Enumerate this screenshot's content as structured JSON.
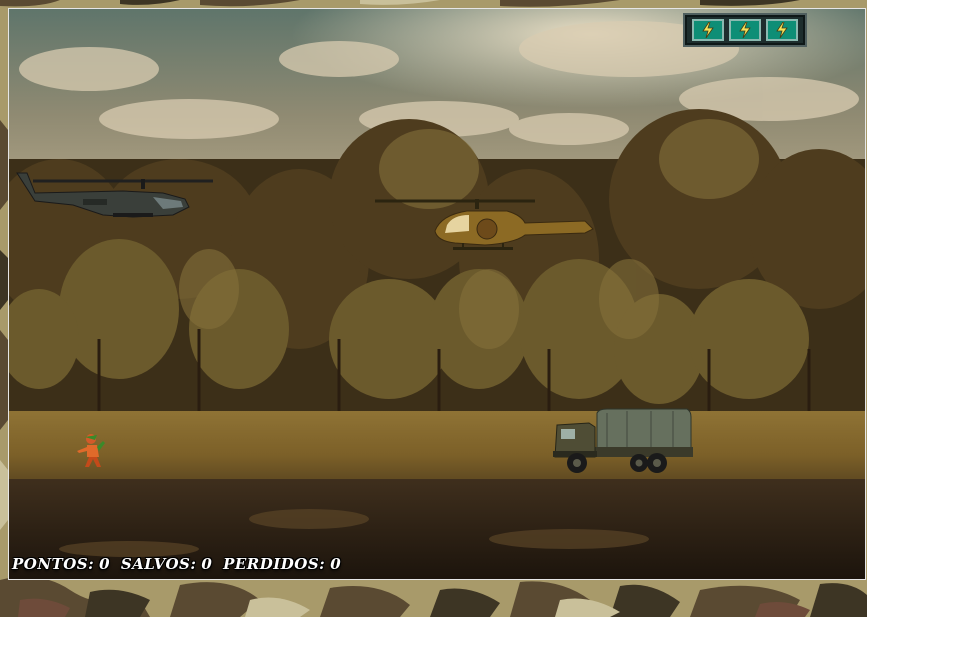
{
  "hud": {
    "score_label": "PONTOS:",
    "score_value": "0",
    "saved_label": "SALVOS:",
    "saved_value": "0",
    "lost_label": "PERDIDOS:",
    "lost_value": "0",
    "energy_cells": 3
  },
  "sprites": {
    "player": "player-helicopter",
    "enemy": "enemy-helicopter",
    "truck": "enemy-truck",
    "friend": "friend-soldier"
  },
  "colors": {
    "energy_cell": "#0e8e76",
    "energy_bolt": "#f2e35a",
    "score_text": "#ffffff"
  }
}
